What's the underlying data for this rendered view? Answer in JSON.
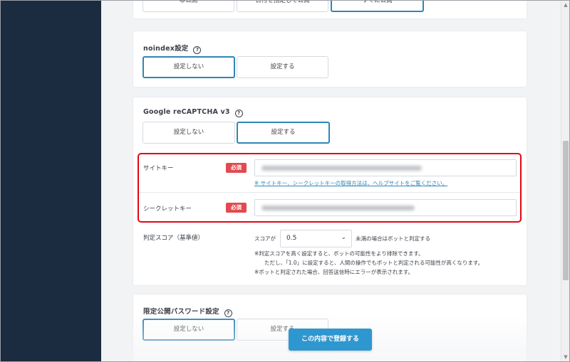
{
  "publish": {
    "options": [
      "非公開",
      "日付を指定して公開",
      "すぐに公開"
    ],
    "active": "すぐに公開"
  },
  "noindex": {
    "title": "noindex設定",
    "help_icon": "?",
    "options": [
      "設定しない",
      "設定する"
    ],
    "active": "設定しない"
  },
  "recaptcha": {
    "title": "Google reCAPTCHA v3",
    "help_icon": "?",
    "options": [
      "設定しない",
      "設定する"
    ],
    "active": "設定する",
    "site_key": {
      "label": "サイトキー",
      "required": "必須",
      "value": "",
      "help_link": "※ サイトキー、シークレットキーの取得方法は、ヘルプサイトをご覧ください。"
    },
    "secret_key": {
      "label": "シークレットキー",
      "required": "必須",
      "value": ""
    },
    "score": {
      "label": "判定スコア（基準値）",
      "prefix": "スコアが",
      "selected": "0.5",
      "suffix": "未満の場合はボットと判定する",
      "notes": [
        "※判定スコアを高く設定すると、ボットの可能性をより排除できます。",
        "ただし、「1.0」に設定すると、人間の操作でもボットと判定される可能性が高くなります。",
        "※ボットと判定された場合、回答送信時にエラーが表示されます。"
      ]
    }
  },
  "password": {
    "title": "限定公開パスワード設定",
    "help_icon": "?",
    "options": [
      "設定しない",
      "設定する"
    ],
    "active": "設定しない"
  },
  "submit_label": "この内容で登録する",
  "colors": {
    "sidebar": "#1b2b40",
    "accent": "#2f86b8",
    "submit": "#2f97cf",
    "required": "#e34a4f",
    "highlight": "#e30613"
  }
}
